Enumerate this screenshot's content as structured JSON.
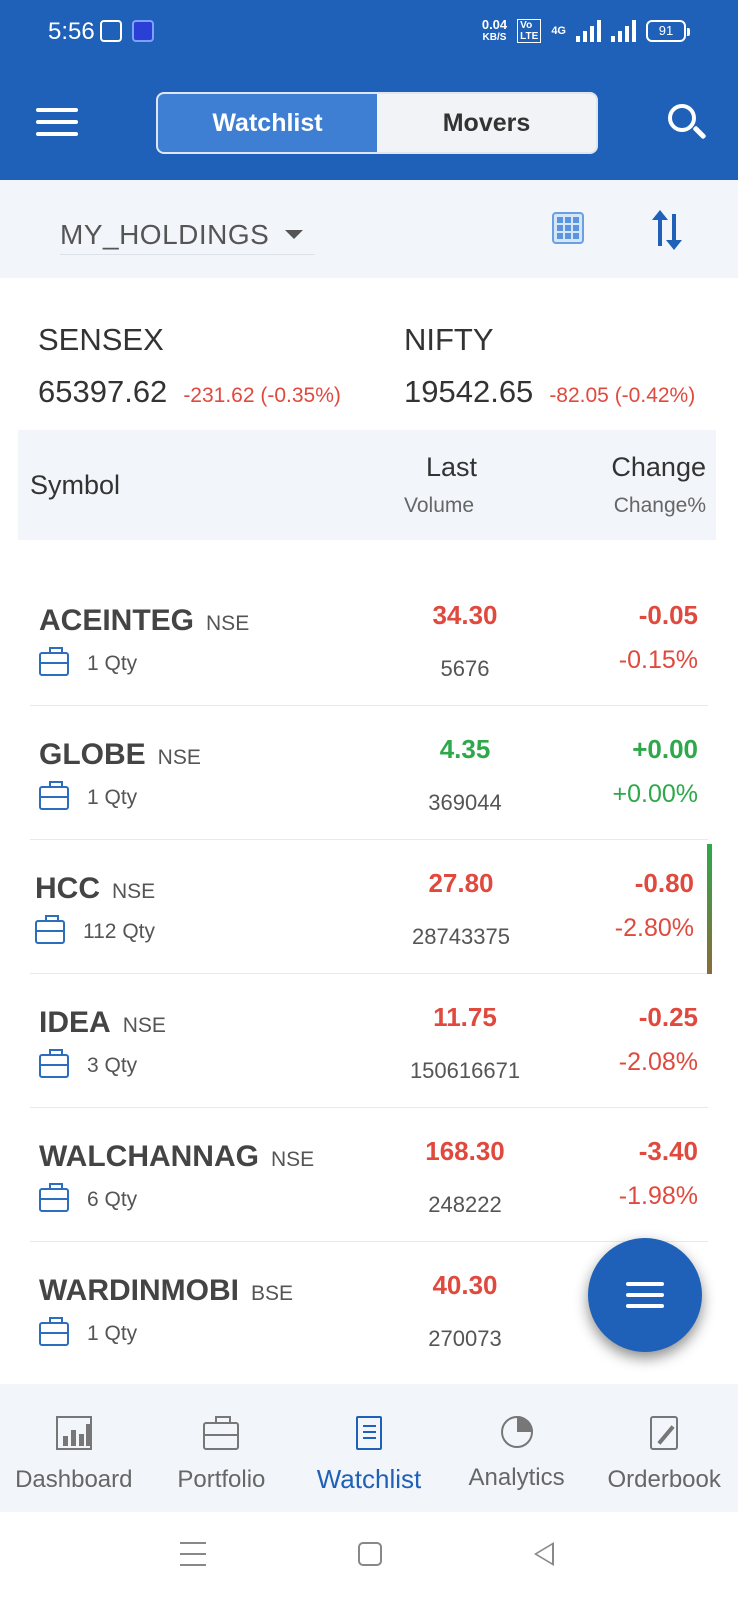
{
  "status_bar": {
    "time": "5:56",
    "net_speed_value": "0.04",
    "net_speed_unit": "KB/S",
    "volte": "VoLTE",
    "network": "4G",
    "battery": "91"
  },
  "header": {
    "tabs": [
      {
        "label": "Watchlist",
        "active": true
      },
      {
        "label": "Movers",
        "active": false
      }
    ]
  },
  "filter": {
    "watchlist_name": "MY_HOLDINGS"
  },
  "indices": [
    {
      "name": "SENSEX",
      "value": "65397.62",
      "change": "-231.62 (-0.35%)"
    },
    {
      "name": "NIFTY",
      "value": "19542.65",
      "change": "-82.05 (-0.42%)"
    }
  ],
  "table_header": {
    "symbol": "Symbol",
    "last": "Last",
    "volume": "Volume",
    "change": "Change",
    "change_pct": "Change%"
  },
  "rows": [
    {
      "symbol": "ACEINTEG",
      "exchange": "NSE",
      "qty": "1 Qty",
      "last": "34.30",
      "volume": "5676",
      "change": "-0.05",
      "change_pct": "-0.15%",
      "trend": "down"
    },
    {
      "symbol": "GLOBE",
      "exchange": "NSE",
      "qty": "1 Qty",
      "last": "4.35",
      "volume": "369044",
      "change": "+0.00",
      "change_pct": "+0.00%",
      "trend": "up"
    },
    {
      "symbol": "HCC",
      "exchange": "NSE",
      "qty": "112 Qty",
      "last": "27.80",
      "volume": "28743375",
      "change": "-0.80",
      "change_pct": "-2.80%",
      "trend": "down"
    },
    {
      "symbol": "IDEA",
      "exchange": "NSE",
      "qty": "3 Qty",
      "last": "11.75",
      "volume": "150616671",
      "change": "-0.25",
      "change_pct": "-2.08%",
      "trend": "down"
    },
    {
      "symbol": "WALCHANNAG",
      "exchange": "NSE",
      "qty": "6 Qty",
      "last": "168.30",
      "volume": "248222",
      "change": "-3.40",
      "change_pct": "-1.98%",
      "trend": "down"
    },
    {
      "symbol": "WARDINMOBI",
      "exchange": "BSE",
      "qty": "1 Qty",
      "last": "40.30",
      "volume": "270073",
      "change": "",
      "change_pct": "",
      "trend": "down"
    }
  ],
  "bottom_nav": [
    {
      "label": "Dashboard",
      "icon": "chart-icon",
      "active": false
    },
    {
      "label": "Portfolio",
      "icon": "briefcase-icon",
      "active": false
    },
    {
      "label": "Watchlist",
      "icon": "document-icon",
      "active": true
    },
    {
      "label": "Analytics",
      "icon": "pie-chart-icon",
      "active": false
    },
    {
      "label": "Orderbook",
      "icon": "edit-note-icon",
      "active": false
    }
  ],
  "colors": {
    "brand": "#1f61b8",
    "negative": "#e0493e",
    "positive": "#2ea84a"
  }
}
